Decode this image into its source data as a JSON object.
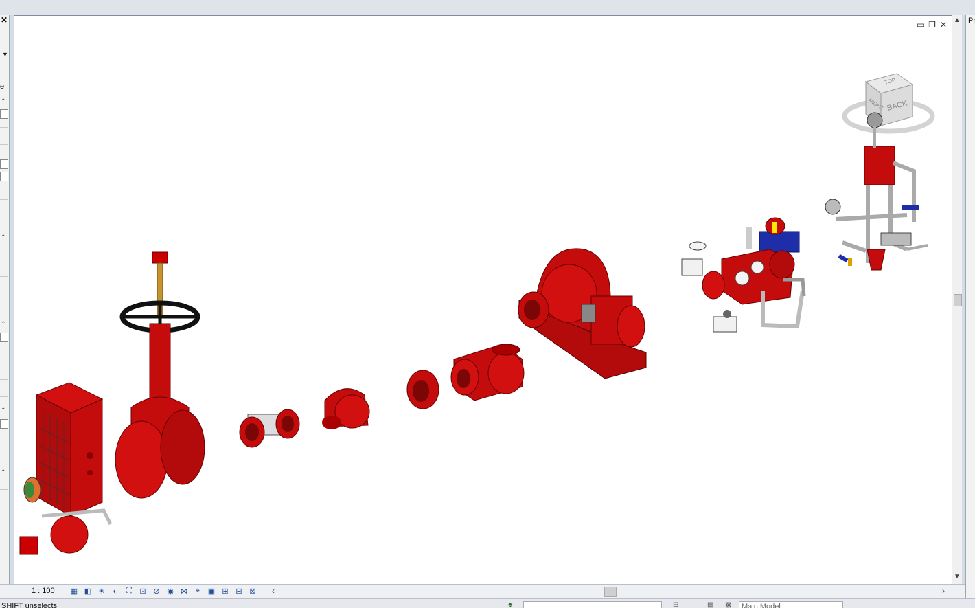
{
  "window": {
    "controls": {
      "minimize": "▭",
      "restore": "❐",
      "close": "✕"
    }
  },
  "left_panel": {
    "close_label": "✕",
    "partial_letter": "e"
  },
  "right_panel": {
    "partial_label": "Pr"
  },
  "view_bar": {
    "scale": "1 : 100",
    "tools": [
      "detail-level-icon",
      "visual-style-icon",
      "sun-path-icon",
      "shadows-icon",
      "crop-view-icon",
      "show-crop-icon",
      "temporary-hide-icon",
      "reveal-hidden-icon",
      "analytical-model-icon",
      "highlight-displacement-icon",
      "rendering-icon",
      "worksharing-icon",
      "design-options-icon",
      "constraints-icon"
    ]
  },
  "status_bar": {
    "text": "SHIFT unselects",
    "workset": "Main Model"
  },
  "viewcube": {
    "top": "TOP",
    "right": "RIGHT",
    "back": "BACK"
  },
  "colors": {
    "red": "#c00d0d",
    "dark_red": "#7a0606",
    "blue": "#1d2ea8",
    "grey": "#bfc3c8"
  }
}
